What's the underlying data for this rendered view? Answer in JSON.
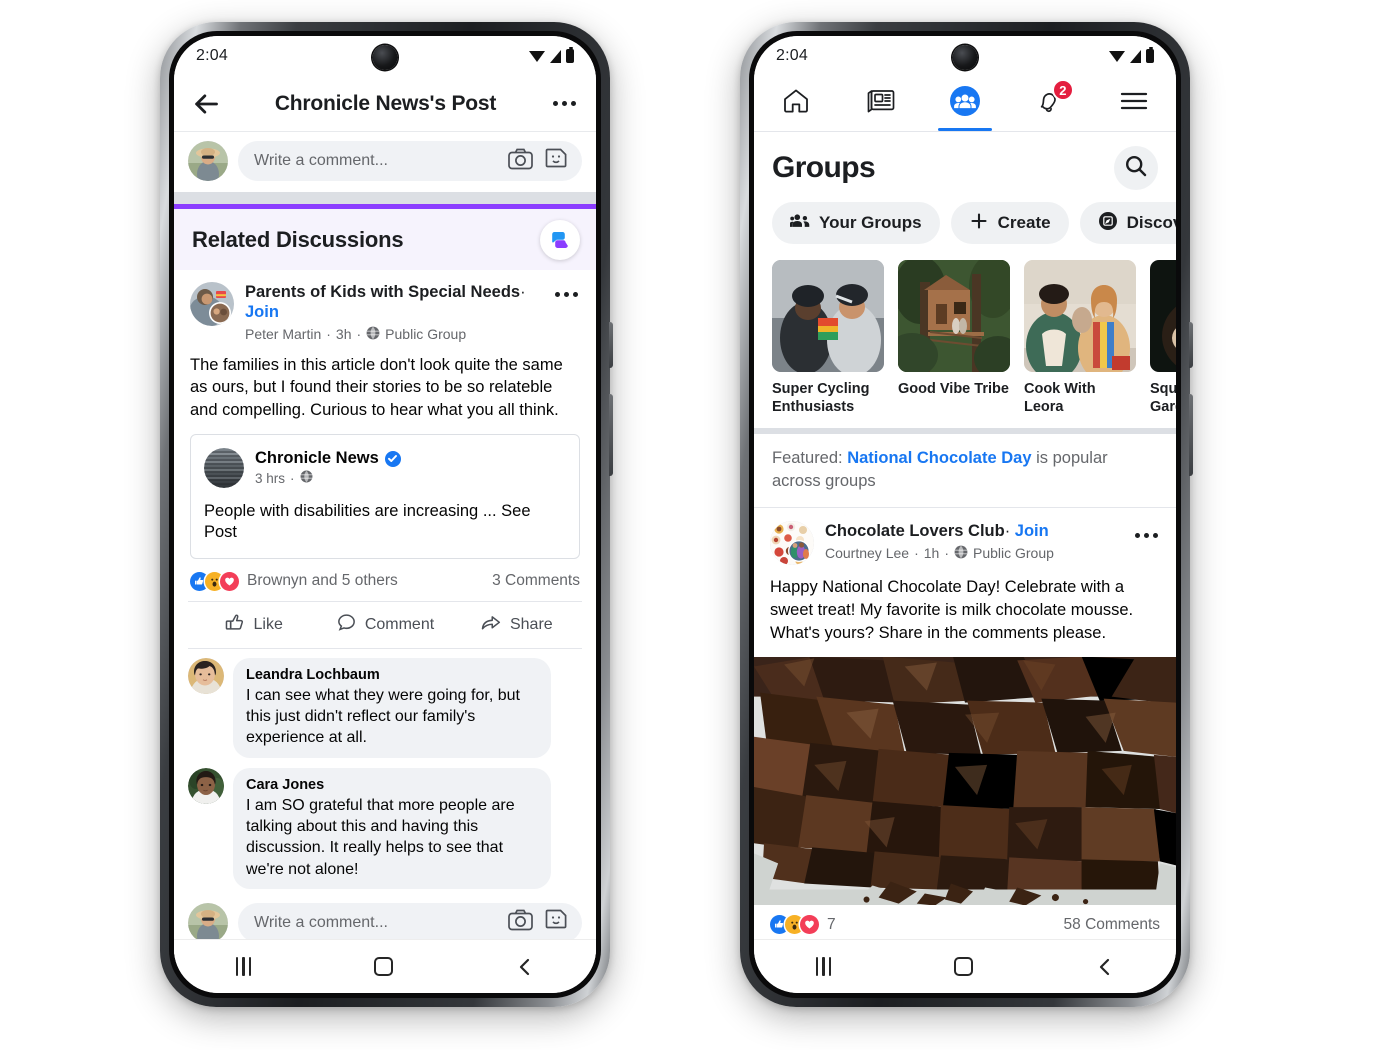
{
  "left_phone": {
    "status": {
      "time": "2:04",
      "icons": [
        "wifi-icon",
        "signal-icon",
        "battery-icon"
      ]
    },
    "appbar": {
      "title": "Chronicle News's Post",
      "back": "back-arrow-icon",
      "menu": "more-options-icon"
    },
    "top_composer": {
      "placeholder": "Write a comment...",
      "camera": "camera-icon",
      "sticker": "sticker-icon"
    },
    "related": {
      "title": "Related Discussions",
      "badge": "related-discussions-icon",
      "accent_color": "#8b3dff",
      "background_color": "#f6f3fd"
    },
    "post": {
      "group_name": "Parents of Kids with Special Needs",
      "separator": "·",
      "join_label": "Join",
      "author": "Peter Martin",
      "time": "3h",
      "privacy": "Public Group",
      "menu": "more-options-icon",
      "text": "The families in this article don't look quite the same as ours, but I found their stories to be so relateble and compelling. Curious to hear what you all think.",
      "embed": {
        "page_name": "Chronicle News",
        "verified": true,
        "time": "3 hrs",
        "privacy_icon": "globe-icon",
        "text": "People with disabilities are increasing ... See Post"
      },
      "reactions": {
        "label": "Brownyn and 5 others",
        "comments": "3 Comments",
        "types": [
          "like",
          "wow",
          "love"
        ]
      },
      "actions": [
        {
          "label": "Like",
          "icon": "thumbs-up-icon"
        },
        {
          "label": "Comment",
          "icon": "comment-bubble-icon"
        },
        {
          "label": "Share",
          "icon": "share-arrow-icon"
        }
      ]
    },
    "comments": [
      {
        "name": "Leandra Lochbaum",
        "text": "I can see what they were going for, but this just didn't reflect our family's experience at all."
      },
      {
        "name": "Cara Jones",
        "text": "I am SO grateful that more people are talking about this and having this discussion. It really helps to see that we're not alone!"
      }
    ],
    "bottom_composer": {
      "placeholder": "Write a comment...",
      "camera": "camera-icon",
      "sticker": "sticker-icon"
    },
    "android_nav": [
      "recents-button",
      "home-button",
      "back-button"
    ]
  },
  "right_phone": {
    "status": {
      "time": "2:04",
      "icons": [
        "wifi-icon",
        "signal-icon",
        "battery-icon"
      ]
    },
    "tabs": [
      {
        "name": "home",
        "icon": "home-icon",
        "active": false
      },
      {
        "name": "news",
        "icon": "news-feed-icon",
        "active": false
      },
      {
        "name": "groups",
        "icon": "groups-icon",
        "active": true
      },
      {
        "name": "notifications",
        "icon": "bell-icon",
        "active": false,
        "badge": "2"
      },
      {
        "name": "menu",
        "icon": "hamburger-menu-icon",
        "active": false
      }
    ],
    "page_title": "Groups",
    "search": "search-icon",
    "chips": [
      {
        "label": "Your Groups",
        "icon": "people-icon"
      },
      {
        "label": "Create",
        "icon": "plus-icon"
      },
      {
        "label": "Discover",
        "icon": "compass-icon"
      }
    ],
    "group_cards": [
      {
        "name": "Super Cycling Enthusiasts"
      },
      {
        "name": "Good Vibe Tribe"
      },
      {
        "name": "Cook With Leora"
      },
      {
        "name": "Square Foot Garden"
      }
    ],
    "featured": {
      "prefix": "Featured: ",
      "link": "National Chocolate Day",
      "suffix": " is popular across groups"
    },
    "post": {
      "group_name": "Chocolate Lovers Club",
      "separator": "·",
      "join_label": "Join",
      "author": "Courtney Lee",
      "time": "1h",
      "privacy": "Public Group",
      "menu": "more-options-icon",
      "text": "Happy National Chocolate Day! Celebrate with a sweet treat! My favorite is milk chocolate mousse. What's yours? Share in the comments please.",
      "image": "chocolate-chunks-photo",
      "reactions": {
        "count": "7",
        "comments": "58 Comments",
        "types": [
          "like",
          "wow",
          "love"
        ]
      }
    },
    "android_nav": [
      "recents-button",
      "home-button",
      "back-button"
    ]
  }
}
